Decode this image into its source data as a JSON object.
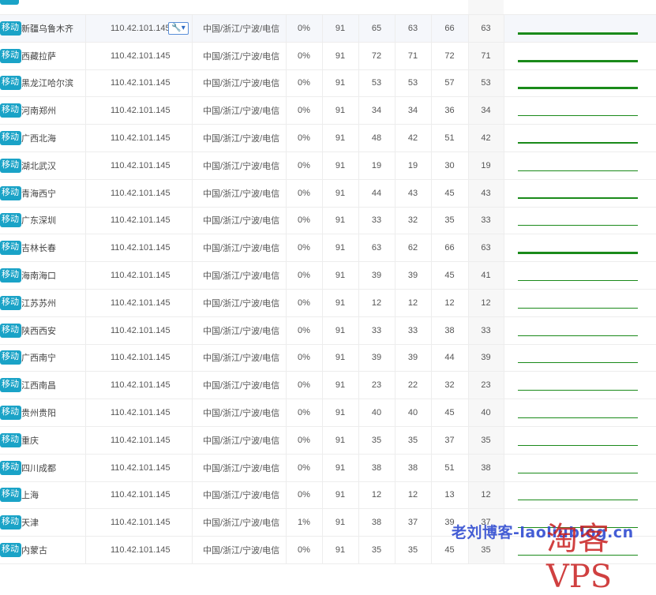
{
  "rows": [
    {
      "isp": "移动",
      "city": "新疆乌鲁木齐",
      "ip": "110.42.101.145",
      "region": "中国/浙江/宁波/电信",
      "loss": "0%",
      "sent": "91",
      "last": "65",
      "avg": "63",
      "worst": "66",
      "best": "63",
      "trend": "thick"
    },
    {
      "isp": "移动",
      "city": "西藏拉萨",
      "ip": "110.42.101.145",
      "region": "中国/浙江/宁波/电信",
      "loss": "0%",
      "sent": "91",
      "last": "72",
      "avg": "71",
      "worst": "72",
      "best": "71",
      "trend": "thick"
    },
    {
      "isp": "移动",
      "city": "黑龙江哈尔滨",
      "ip": "110.42.101.145",
      "region": "中国/浙江/宁波/电信",
      "loss": "0%",
      "sent": "91",
      "last": "53",
      "avg": "53",
      "worst": "57",
      "best": "53",
      "trend": "thick"
    },
    {
      "isp": "移动",
      "city": "河南郑州",
      "ip": "110.42.101.145",
      "region": "中国/浙江/宁波/电信",
      "loss": "0%",
      "sent": "91",
      "last": "34",
      "avg": "34",
      "worst": "36",
      "best": "34",
      "trend": "thin"
    },
    {
      "isp": "移动",
      "city": "广西北海",
      "ip": "110.42.101.145",
      "region": "中国/浙江/宁波/电信",
      "loss": "0%",
      "sent": "91",
      "last": "48",
      "avg": "42",
      "worst": "51",
      "best": "42",
      "trend": "medium"
    },
    {
      "isp": "移动",
      "city": "湖北武汉",
      "ip": "110.42.101.145",
      "region": "中国/浙江/宁波/电信",
      "loss": "0%",
      "sent": "91",
      "last": "19",
      "avg": "19",
      "worst": "30",
      "best": "19",
      "trend": "thin"
    },
    {
      "isp": "移动",
      "city": "青海西宁",
      "ip": "110.42.101.145",
      "region": "中国/浙江/宁波/电信",
      "loss": "0%",
      "sent": "91",
      "last": "44",
      "avg": "43",
      "worst": "45",
      "best": "43",
      "trend": "medium"
    },
    {
      "isp": "移动",
      "city": "广东深圳",
      "ip": "110.42.101.145",
      "region": "中国/浙江/宁波/电信",
      "loss": "0%",
      "sent": "91",
      "last": "33",
      "avg": "32",
      "worst": "35",
      "best": "33",
      "trend": "thin"
    },
    {
      "isp": "移动",
      "city": "吉林长春",
      "ip": "110.42.101.145",
      "region": "中国/浙江/宁波/电信",
      "loss": "0%",
      "sent": "91",
      "last": "63",
      "avg": "62",
      "worst": "66",
      "best": "63",
      "trend": "thick"
    },
    {
      "isp": "移动",
      "city": "海南海口",
      "ip": "110.42.101.145",
      "region": "中国/浙江/宁波/电信",
      "loss": "0%",
      "sent": "91",
      "last": "39",
      "avg": "39",
      "worst": "45",
      "best": "41",
      "trend": "thin"
    },
    {
      "isp": "移动",
      "city": "江苏苏州",
      "ip": "110.42.101.145",
      "region": "中国/浙江/宁波/电信",
      "loss": "0%",
      "sent": "91",
      "last": "12",
      "avg": "12",
      "worst": "12",
      "best": "12",
      "trend": "thin"
    },
    {
      "isp": "移动",
      "city": "陕西西安",
      "ip": "110.42.101.145",
      "region": "中国/浙江/宁波/电信",
      "loss": "0%",
      "sent": "91",
      "last": "33",
      "avg": "33",
      "worst": "38",
      "best": "33",
      "trend": "thin"
    },
    {
      "isp": "移动",
      "city": "广西南宁",
      "ip": "110.42.101.145",
      "region": "中国/浙江/宁波/电信",
      "loss": "0%",
      "sent": "91",
      "last": "39",
      "avg": "39",
      "worst": "44",
      "best": "39",
      "trend": "thin"
    },
    {
      "isp": "移动",
      "city": "江西南昌",
      "ip": "110.42.101.145",
      "region": "中国/浙江/宁波/电信",
      "loss": "0%",
      "sent": "91",
      "last": "23",
      "avg": "22",
      "worst": "32",
      "best": "23",
      "trend": "thin"
    },
    {
      "isp": "移动",
      "city": "贵州贵阳",
      "ip": "110.42.101.145",
      "region": "中国/浙江/宁波/电信",
      "loss": "0%",
      "sent": "91",
      "last": "40",
      "avg": "40",
      "worst": "45",
      "best": "40",
      "trend": "thin"
    },
    {
      "isp": "移动",
      "city": "重庆",
      "ip": "110.42.101.145",
      "region": "中国/浙江/宁波/电信",
      "loss": "0%",
      "sent": "91",
      "last": "35",
      "avg": "35",
      "worst": "37",
      "best": "35",
      "trend": "thin"
    },
    {
      "isp": "移动",
      "city": "四川成都",
      "ip": "110.42.101.145",
      "region": "中国/浙江/宁波/电信",
      "loss": "0%",
      "sent": "91",
      "last": "38",
      "avg": "38",
      "worst": "51",
      "best": "38",
      "trend": "thin"
    },
    {
      "isp": "移动",
      "city": "上海",
      "ip": "110.42.101.145",
      "region": "中国/浙江/宁波/电信",
      "loss": "0%",
      "sent": "91",
      "last": "12",
      "avg": "12",
      "worst": "13",
      "best": "12",
      "trend": "thin"
    },
    {
      "isp": "移动",
      "city": "天津",
      "ip": "110.42.101.145",
      "region": "中国/浙江/宁波/电信",
      "loss": "1%",
      "sent": "91",
      "last": "38",
      "avg": "37",
      "worst": "39",
      "best": "37",
      "trend": "thin"
    },
    {
      "isp": "移动",
      "city": "内蒙古",
      "ip": "110.42.101.145",
      "region": "中国/浙江/宁波/电信",
      "loss": "0%",
      "sent": "91",
      "last": "35",
      "avg": "35",
      "worst": "45",
      "best": "35",
      "trend": "thin"
    }
  ],
  "watermark": {
    "blog": "老刘博客-laoliublog.cn",
    "brand": "淘客VPS"
  },
  "icons": {
    "tool": "wrench-dropdown-icon"
  },
  "colors": {
    "tag": "#1aa3c7",
    "trend": "#1a8a1a",
    "watermark_blue": "#3550d2",
    "watermark_red": "#c81f1f"
  }
}
